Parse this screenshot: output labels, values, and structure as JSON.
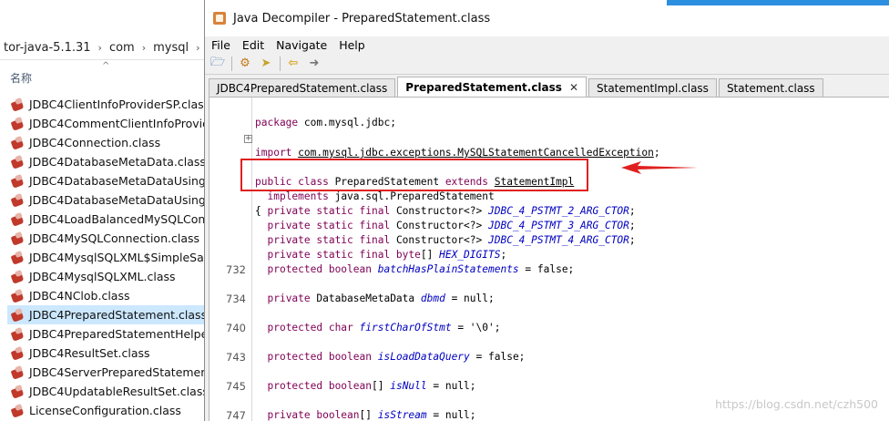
{
  "explorer": {
    "breadcrumb": [
      "tor-java-5.1.31",
      "com",
      "mysql",
      "jd"
    ],
    "column_header": "名称",
    "files": [
      "JDBC4ClientInfoProviderSP.class",
      "JDBC4CommentClientInfoProvide",
      "JDBC4Connection.class",
      "JDBC4DatabaseMetaData.class",
      "JDBC4DatabaseMetaDataUsingIn",
      "JDBC4DatabaseMetaDataUsingIn",
      "JDBC4LoadBalancedMySQLConne",
      "JDBC4MySQLConnection.class",
      "JDBC4MysqlSQLXML$SimpleSaxT",
      "JDBC4MysqlSQLXML.class",
      "JDBC4NClob.class",
      "JDBC4PreparedStatement.class",
      "JDBC4PreparedStatementHelper.",
      "JDBC4ResultSet.class",
      "JDBC4ServerPreparedStatement.c",
      "JDBC4UpdatableResultSet.class",
      "LicenseConfiguration.class"
    ],
    "selected_index": 11
  },
  "decompiler": {
    "title": "Java Decompiler - PreparedStatement.class",
    "menu": [
      "File",
      "Edit",
      "Navigate",
      "Help"
    ],
    "toolbar_icons": [
      "open-file-icon",
      "open-type-icon",
      "search-icon",
      "back-icon",
      "forward-icon"
    ],
    "tabs": [
      {
        "label": "JDBC4PreparedStatement.class",
        "active": false
      },
      {
        "label": "PreparedStatement.class",
        "active": true,
        "close": "✕"
      },
      {
        "label": "StatementImpl.class",
        "active": false
      },
      {
        "label": "Statement.class",
        "active": false
      }
    ],
    "code": {
      "package_kw": "package",
      "package_name": " com.mysql.jdbc;",
      "import_kw": "import",
      "import_name": "com.mysql.jdbc.exceptions.MySQLStatementCancelledException",
      "class_decl_kw": "public class",
      "class_name": " PreparedStatement ",
      "extends_kw": "extends",
      "superclass": "StatementImpl",
      "implements_kw": "implements",
      "interface": " java.sql.PreparedStatement",
      "brace": "{",
      "fields": [
        {
          "mods": "private static final",
          "type": " Constructor<?> ",
          "name": "JDBC_4_PSTMT_2_ARG_CTOR",
          "tail": ";",
          "line": ""
        },
        {
          "mods": "private static final",
          "type": " Constructor<?> ",
          "name": "JDBC_4_PSTMT_3_ARG_CTOR",
          "tail": ";",
          "line": ""
        },
        {
          "mods": "private static final",
          "type": " Constructor<?> ",
          "name": "JDBC_4_PSTMT_4_ARG_CTOR",
          "tail": ";",
          "line": ""
        },
        {
          "mods": "private static final byte",
          "type": "[] ",
          "name": "HEX_DIGITS",
          "tail": ";",
          "line": ""
        },
        {
          "mods": "protected boolean",
          "type": " ",
          "name": "batchHasPlainStatements",
          "tail": " = false;",
          "line": "732"
        },
        {
          "mods": "private",
          "type": " DatabaseMetaData ",
          "name": "dbmd",
          "tail": " = null;",
          "line": "734"
        },
        {
          "mods": "protected char",
          "type": " ",
          "name": "firstCharOfStmt",
          "tail": " = '\\0';",
          "line": "740"
        },
        {
          "mods": "protected boolean",
          "type": " ",
          "name": "isLoadDataQuery",
          "tail": " = false;",
          "line": "743"
        },
        {
          "mods": "protected boolean",
          "type": "[] ",
          "name": "isNull",
          "tail": " = null;",
          "line": "745"
        },
        {
          "mods": "private boolean",
          "type": "[] ",
          "name": "isStream",
          "tail": " = null;",
          "line": "747"
        }
      ]
    }
  },
  "watermark": "https://blog.csdn.net/czh500",
  "colors": {
    "annotation_red": "#e02020",
    "selection": "#cce8ff",
    "keyword": "#7f0055",
    "field": "#0000c0"
  }
}
